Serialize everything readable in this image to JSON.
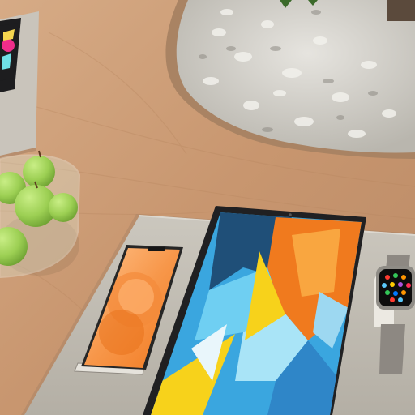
{
  "scene": {
    "colors": {
      "desk": "#c99b76",
      "desk_grain": "#b88760",
      "planter_stone": "#dcdad4",
      "felt_mat": "#bdb8ae",
      "apple": "#9fd25a",
      "ipad_orange": "#f07a1e",
      "ipad_blue": "#4fb3e6",
      "ipad_yellow": "#f7d21b",
      "phone_orange": "#f7a256",
      "watch_band": "#8d8882"
    },
    "objects": [
      "wooden-desk",
      "stone-planter",
      "tablet-on-mat",
      "glass-fruit-bowl",
      "green-apples",
      "charging-mat",
      "smartphone",
      "tablet",
      "smartwatch"
    ]
  }
}
